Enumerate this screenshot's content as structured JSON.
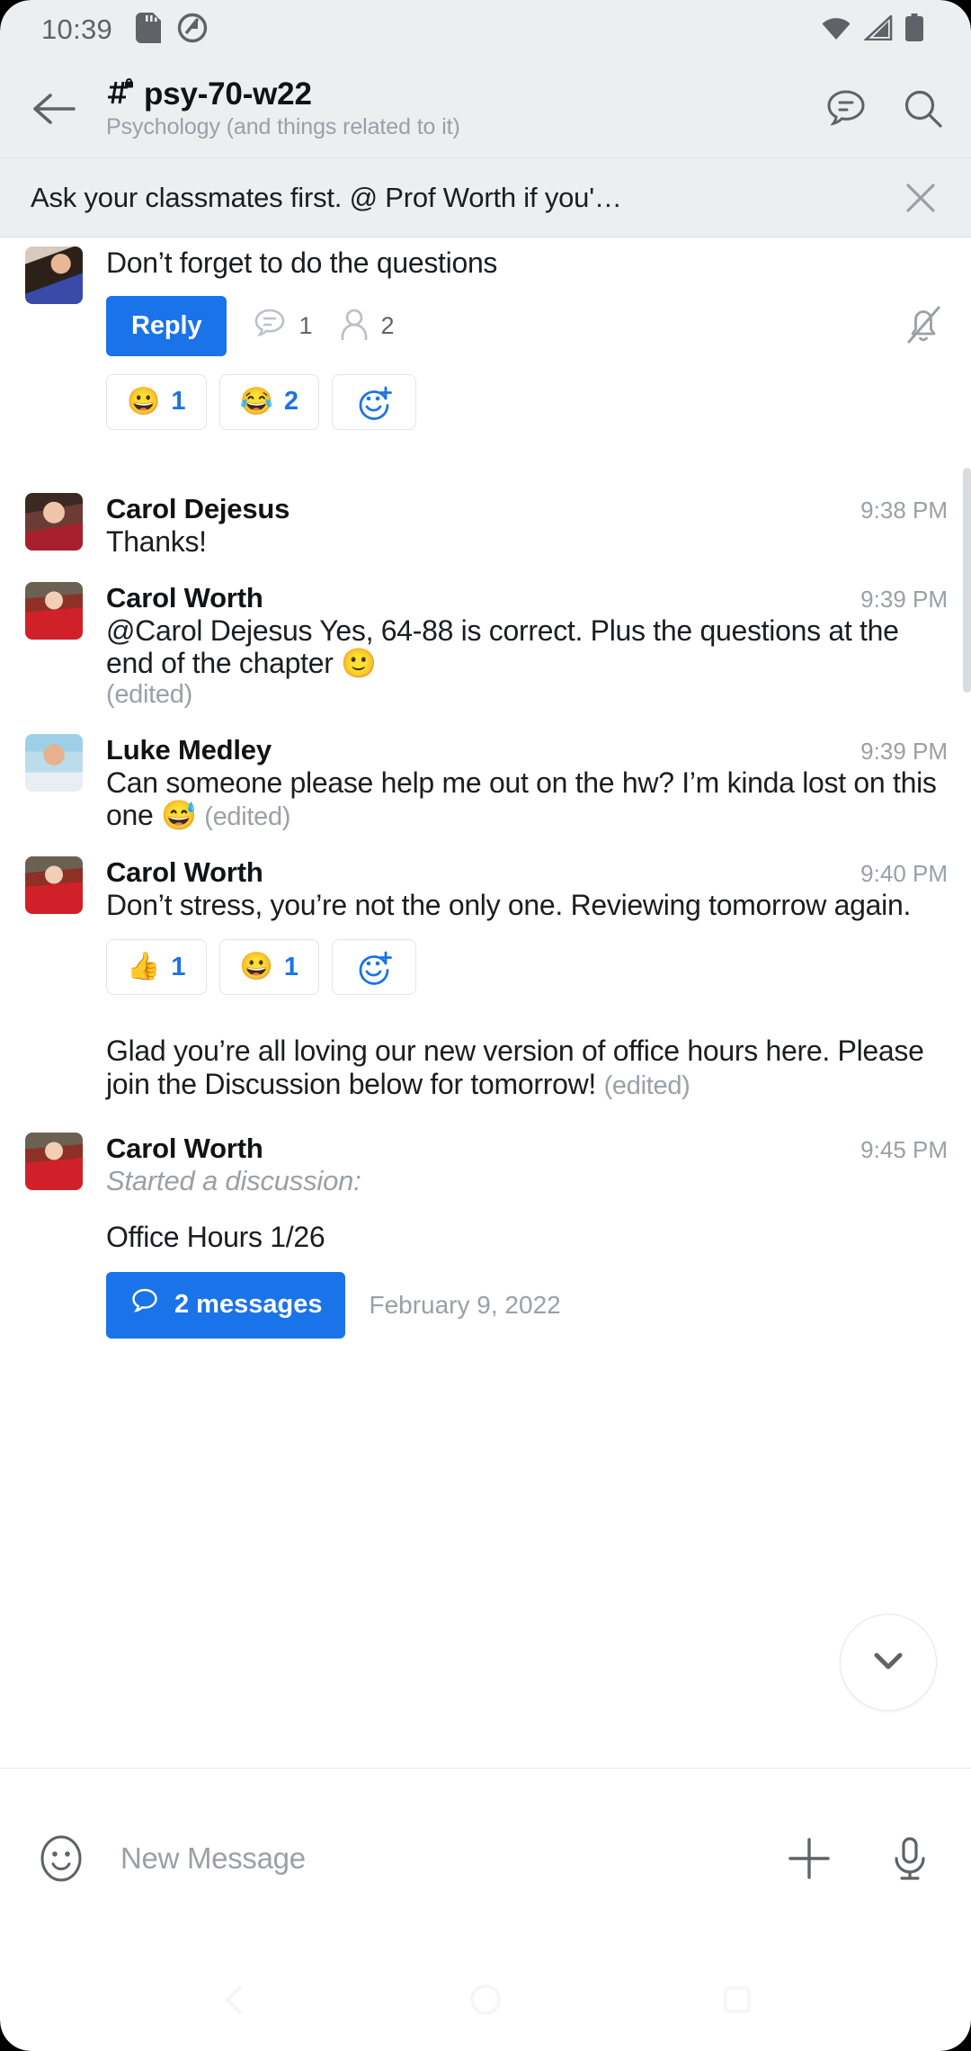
{
  "status_bar": {
    "time": "10:39",
    "icons": [
      "sd-card-icon",
      "do-not-disturb-icon"
    ],
    "right_icons": [
      "wifi-icon",
      "cell-signal-icon",
      "battery-icon"
    ]
  },
  "header": {
    "back_icon": "back-arrow-icon",
    "channel_icon": "private-channel-icon",
    "title": "psy-70-w22",
    "subtitle": "Psychology (and things related to it)",
    "actions": [
      "threads-icon",
      "search-icon"
    ]
  },
  "pinned_banner": {
    "text": "Ask your classmates first. @ Prof Worth if you'…",
    "close_icon": "close-icon"
  },
  "messages": [
    {
      "id": "msg-questions",
      "avatar": "av-ana",
      "author": "",
      "timestamp": "",
      "text": "Don’t forget to do the questions",
      "edited": "",
      "reply_label": "Reply",
      "thread_count": "1",
      "participant_count": "2",
      "mute_icon": "bell-off-icon",
      "reactions": [
        {
          "emoji": "😀",
          "name": "grinning-face-reaction",
          "count": "1"
        },
        {
          "emoji": "😂",
          "name": "tears-of-joy-reaction",
          "count": "2"
        }
      ],
      "add_reaction_icon": "add-reaction-icon"
    },
    {
      "id": "msg-thanks",
      "avatar": "av-carol-d",
      "author": "Carol Dejesus",
      "timestamp": "9:38 PM",
      "text": "Thanks!",
      "edited": ""
    },
    {
      "id": "msg-pages",
      "avatar": "av-carol-w",
      "author": "Carol Worth",
      "timestamp": "9:39 PM",
      "text": "@Carol Dejesus Yes, 64-88 is correct. Plus the questions at the end of the chapter 🙂",
      "edited": "(edited)",
      "edited_on_new_line": true
    },
    {
      "id": "msg-help",
      "avatar": "av-luke",
      "author": "Luke Medley",
      "timestamp": "9:39 PM",
      "text": "Can someone please help me out on the hw? I’m kinda lost on this one 😅",
      "edited": "(edited)"
    },
    {
      "id": "msg-dont-stress",
      "avatar": "av-carol-w",
      "author": "Carol Worth",
      "timestamp": "9:40 PM",
      "text": "Don’t stress, you’re not the only one. Reviewing tomorrow again.",
      "edited": "",
      "reactions": [
        {
          "emoji": "👍",
          "name": "thumbs-up-reaction",
          "count": "1"
        },
        {
          "emoji": "😀",
          "name": "grinning-face-reaction",
          "count": "1"
        }
      ],
      "add_reaction_icon": "add-reaction-icon"
    },
    {
      "id": "msg-office-hours-note",
      "avatar": "",
      "author": "",
      "timestamp": "",
      "text": "Glad you’re all loving our new version of office hours here. Please join the Discussion below for tomorrow!",
      "edited": "(edited)"
    },
    {
      "id": "msg-discussion",
      "avatar": "av-carol-w",
      "author": "Carol Worth",
      "timestamp": "9:45 PM",
      "started_discussion_label": "Started a discussion:",
      "discussion_title": "Office Hours 1/26",
      "messages_button": {
        "icon": "discussion-bubble-icon",
        "label": "2 messages"
      },
      "date": "February 9, 2022"
    }
  ],
  "scroll_fab": {
    "icon": "chevron-down-icon"
  },
  "composer": {
    "emoji_icon": "emoji-face-icon",
    "placeholder": "New Message",
    "plus_icon": "plus-icon",
    "mic_icon": "microphone-icon"
  },
  "nav_bar": {
    "back_icon": "nav-back-icon",
    "home_icon": "nav-home-icon",
    "recents_icon": "nav-recents-icon"
  },
  "colors": {
    "accent": "#1a73e8",
    "chrome": "#edeef0",
    "text": "#1c1d20",
    "muted": "#9aa0a6"
  }
}
